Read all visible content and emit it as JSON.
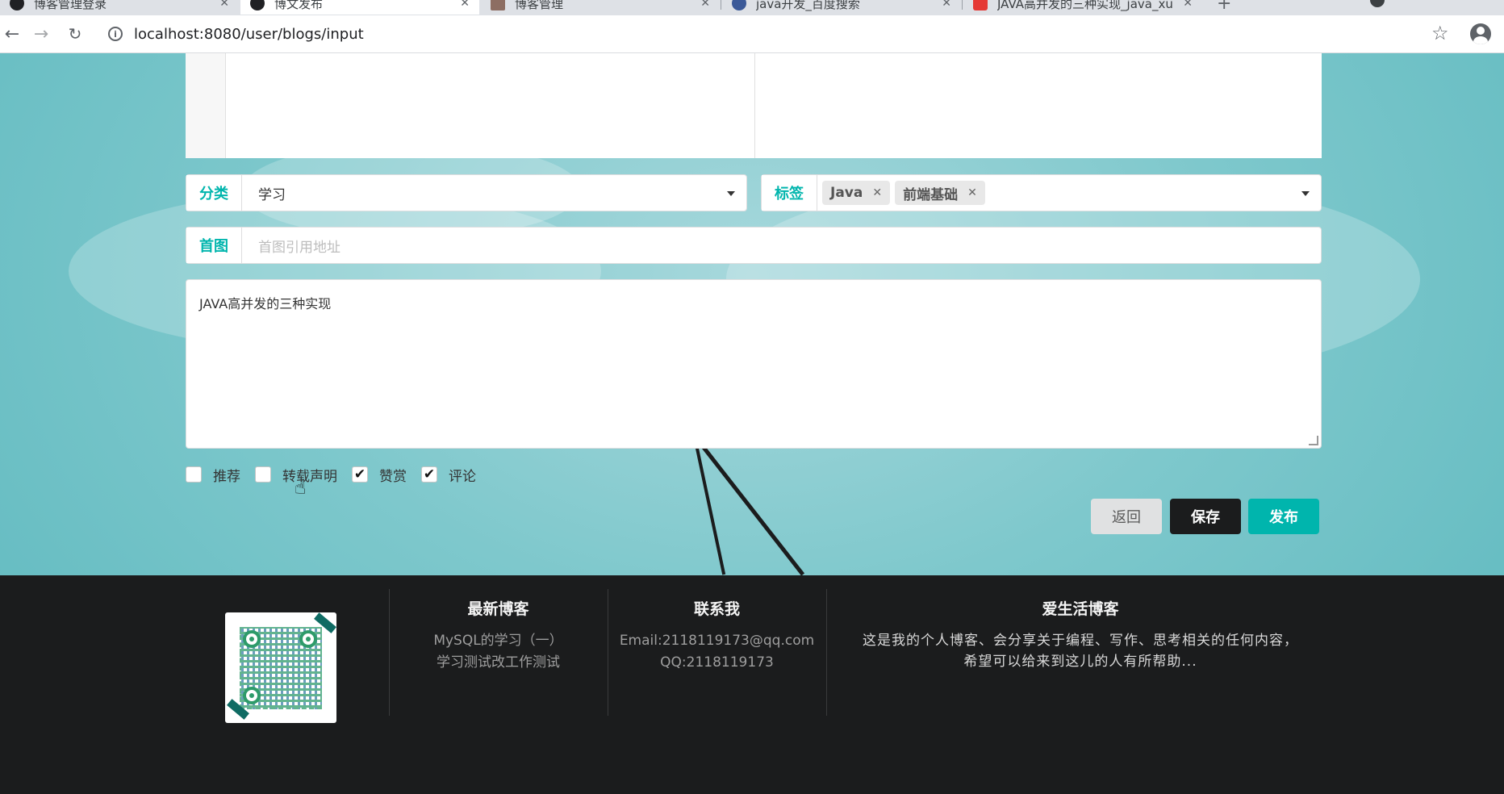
{
  "browser": {
    "tabs": [
      {
        "title": "博客管理登录",
        "favicon_color": "#202124",
        "active": false
      },
      {
        "title": "博文发布",
        "favicon_color": "#202124",
        "active": true
      },
      {
        "title": "博客管理",
        "favicon_color": "#8d6e63",
        "active": false
      },
      {
        "title": "java开发_百度搜索",
        "favicon_color": "#3b5998",
        "active": false
      },
      {
        "title": "JAVA高并发的三种实现_java_xu",
        "favicon_color": "#e53935",
        "active": false
      }
    ],
    "url": "localhost:8080/user/blogs/input",
    "icons": {
      "back": "back-arrow-icon",
      "forward": "forward-arrow-icon",
      "reload": "reload-icon",
      "bookmark": "star-icon"
    }
  },
  "form": {
    "category": {
      "label": "分类",
      "value": "学习"
    },
    "tags": {
      "label": "标签",
      "chips": [
        "Java",
        "前端基础"
      ]
    },
    "cover": {
      "label": "首图",
      "placeholder": "首图引用地址"
    },
    "description": "JAVA高并发的三种实现",
    "checkboxes": [
      {
        "label": "推荐",
        "checked": false
      },
      {
        "label": "转载声明",
        "checked": false
      },
      {
        "label": "赞赏",
        "checked": true
      },
      {
        "label": "评论",
        "checked": true
      }
    ],
    "buttons": {
      "back": "返回",
      "save": "保存",
      "publish": "发布"
    }
  },
  "footer": {
    "latest": {
      "title": "最新博客",
      "items": [
        "MySQL的学习（一）",
        "学习测试改工作测试"
      ]
    },
    "contact": {
      "title": "联系我",
      "email": "Email:2118119173@qq.com",
      "qq": "QQ:2118119173"
    },
    "about": {
      "title": "爱生活博客",
      "text1": "这是我的个人博客、会分享关于编程、写作、思考相关的任何内容，",
      "text2": "希望可以给来到这儿的人有所帮助..."
    }
  },
  "colors": {
    "accent": "#00b5ad",
    "dark": "#1b1c1d",
    "footer_bg": "#1b1c1d"
  }
}
